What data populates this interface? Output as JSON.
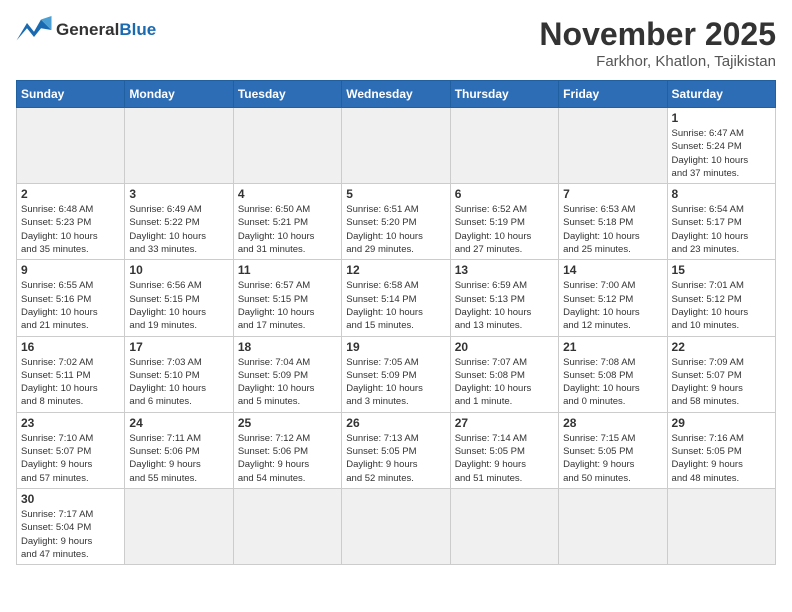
{
  "header": {
    "logo_line1": "General",
    "logo_line2": "Blue",
    "month": "November 2025",
    "location": "Farkhor, Khatlon, Tajikistan"
  },
  "weekdays": [
    "Sunday",
    "Monday",
    "Tuesday",
    "Wednesday",
    "Thursday",
    "Friday",
    "Saturday"
  ],
  "weeks": [
    [
      {
        "day": "",
        "info": ""
      },
      {
        "day": "",
        "info": ""
      },
      {
        "day": "",
        "info": ""
      },
      {
        "day": "",
        "info": ""
      },
      {
        "day": "",
        "info": ""
      },
      {
        "day": "",
        "info": ""
      },
      {
        "day": "1",
        "info": "Sunrise: 6:47 AM\nSunset: 5:24 PM\nDaylight: 10 hours\nand 37 minutes."
      }
    ],
    [
      {
        "day": "2",
        "info": "Sunrise: 6:48 AM\nSunset: 5:23 PM\nDaylight: 10 hours\nand 35 minutes."
      },
      {
        "day": "3",
        "info": "Sunrise: 6:49 AM\nSunset: 5:22 PM\nDaylight: 10 hours\nand 33 minutes."
      },
      {
        "day": "4",
        "info": "Sunrise: 6:50 AM\nSunset: 5:21 PM\nDaylight: 10 hours\nand 31 minutes."
      },
      {
        "day": "5",
        "info": "Sunrise: 6:51 AM\nSunset: 5:20 PM\nDaylight: 10 hours\nand 29 minutes."
      },
      {
        "day": "6",
        "info": "Sunrise: 6:52 AM\nSunset: 5:19 PM\nDaylight: 10 hours\nand 27 minutes."
      },
      {
        "day": "7",
        "info": "Sunrise: 6:53 AM\nSunset: 5:18 PM\nDaylight: 10 hours\nand 25 minutes."
      },
      {
        "day": "8",
        "info": "Sunrise: 6:54 AM\nSunset: 5:17 PM\nDaylight: 10 hours\nand 23 minutes."
      }
    ],
    [
      {
        "day": "9",
        "info": "Sunrise: 6:55 AM\nSunset: 5:16 PM\nDaylight: 10 hours\nand 21 minutes."
      },
      {
        "day": "10",
        "info": "Sunrise: 6:56 AM\nSunset: 5:15 PM\nDaylight: 10 hours\nand 19 minutes."
      },
      {
        "day": "11",
        "info": "Sunrise: 6:57 AM\nSunset: 5:15 PM\nDaylight: 10 hours\nand 17 minutes."
      },
      {
        "day": "12",
        "info": "Sunrise: 6:58 AM\nSunset: 5:14 PM\nDaylight: 10 hours\nand 15 minutes."
      },
      {
        "day": "13",
        "info": "Sunrise: 6:59 AM\nSunset: 5:13 PM\nDaylight: 10 hours\nand 13 minutes."
      },
      {
        "day": "14",
        "info": "Sunrise: 7:00 AM\nSunset: 5:12 PM\nDaylight: 10 hours\nand 12 minutes."
      },
      {
        "day": "15",
        "info": "Sunrise: 7:01 AM\nSunset: 5:12 PM\nDaylight: 10 hours\nand 10 minutes."
      }
    ],
    [
      {
        "day": "16",
        "info": "Sunrise: 7:02 AM\nSunset: 5:11 PM\nDaylight: 10 hours\nand 8 minutes."
      },
      {
        "day": "17",
        "info": "Sunrise: 7:03 AM\nSunset: 5:10 PM\nDaylight: 10 hours\nand 6 minutes."
      },
      {
        "day": "18",
        "info": "Sunrise: 7:04 AM\nSunset: 5:09 PM\nDaylight: 10 hours\nand 5 minutes."
      },
      {
        "day": "19",
        "info": "Sunrise: 7:05 AM\nSunset: 5:09 PM\nDaylight: 10 hours\nand 3 minutes."
      },
      {
        "day": "20",
        "info": "Sunrise: 7:07 AM\nSunset: 5:08 PM\nDaylight: 10 hours\nand 1 minute."
      },
      {
        "day": "21",
        "info": "Sunrise: 7:08 AM\nSunset: 5:08 PM\nDaylight: 10 hours\nand 0 minutes."
      },
      {
        "day": "22",
        "info": "Sunrise: 7:09 AM\nSunset: 5:07 PM\nDaylight: 9 hours\nand 58 minutes."
      }
    ],
    [
      {
        "day": "23",
        "info": "Sunrise: 7:10 AM\nSunset: 5:07 PM\nDaylight: 9 hours\nand 57 minutes."
      },
      {
        "day": "24",
        "info": "Sunrise: 7:11 AM\nSunset: 5:06 PM\nDaylight: 9 hours\nand 55 minutes."
      },
      {
        "day": "25",
        "info": "Sunrise: 7:12 AM\nSunset: 5:06 PM\nDaylight: 9 hours\nand 54 minutes."
      },
      {
        "day": "26",
        "info": "Sunrise: 7:13 AM\nSunset: 5:05 PM\nDaylight: 9 hours\nand 52 minutes."
      },
      {
        "day": "27",
        "info": "Sunrise: 7:14 AM\nSunset: 5:05 PM\nDaylight: 9 hours\nand 51 minutes."
      },
      {
        "day": "28",
        "info": "Sunrise: 7:15 AM\nSunset: 5:05 PM\nDaylight: 9 hours\nand 50 minutes."
      },
      {
        "day": "29",
        "info": "Sunrise: 7:16 AM\nSunset: 5:05 PM\nDaylight: 9 hours\nand 48 minutes."
      }
    ],
    [
      {
        "day": "30",
        "info": "Sunrise: 7:17 AM\nSunset: 5:04 PM\nDaylight: 9 hours\nand 47 minutes."
      },
      {
        "day": "",
        "info": ""
      },
      {
        "day": "",
        "info": ""
      },
      {
        "day": "",
        "info": ""
      },
      {
        "day": "",
        "info": ""
      },
      {
        "day": "",
        "info": ""
      },
      {
        "day": "",
        "info": ""
      }
    ]
  ]
}
